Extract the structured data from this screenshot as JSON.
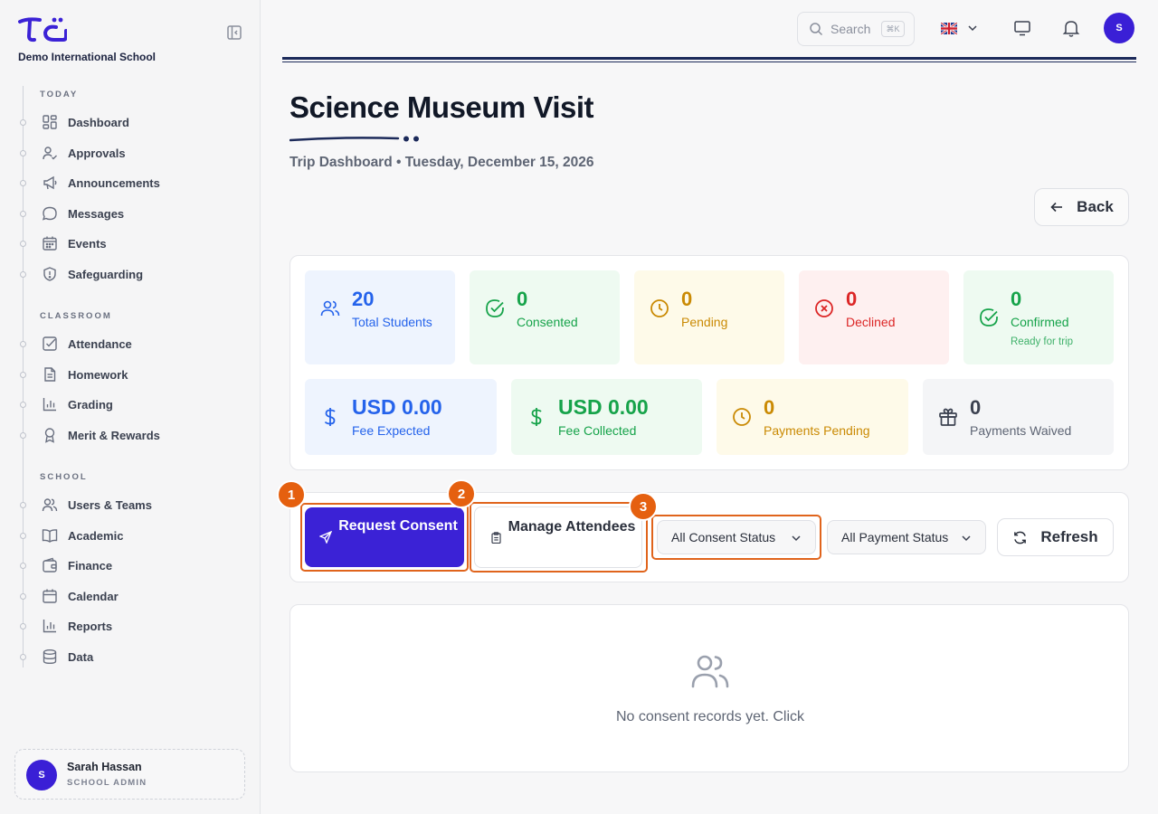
{
  "sidebar": {
    "school_name": "Demo International School",
    "sections": [
      {
        "label": "TODAY",
        "items": [
          {
            "label": "Dashboard",
            "icon": "dashboard-icon"
          },
          {
            "label": "Approvals",
            "icon": "user-check-icon"
          },
          {
            "label": "Announcements",
            "icon": "megaphone-icon"
          },
          {
            "label": "Messages",
            "icon": "chat-bubble-icon"
          },
          {
            "label": "Events",
            "icon": "calendar-grid-icon"
          },
          {
            "label": "Safeguarding",
            "icon": "shield-icon"
          }
        ]
      },
      {
        "label": "CLASSROOM",
        "items": [
          {
            "label": "Attendance",
            "icon": "checkbox-icon"
          },
          {
            "label": "Homework",
            "icon": "document-icon"
          },
          {
            "label": "Grading",
            "icon": "bar-chart-icon"
          },
          {
            "label": "Merit & Rewards",
            "icon": "award-icon"
          }
        ]
      },
      {
        "label": "SCHOOL",
        "items": [
          {
            "label": "Users & Teams",
            "icon": "users-icon"
          },
          {
            "label": "Academic",
            "icon": "book-icon"
          },
          {
            "label": "Finance",
            "icon": "wallet-icon"
          },
          {
            "label": "Calendar",
            "icon": "calendar-icon"
          },
          {
            "label": "Reports",
            "icon": "bar-chart-icon"
          },
          {
            "label": "Data",
            "icon": "database-icon"
          }
        ]
      }
    ],
    "user": {
      "initial": "S",
      "name": "Sarah Hassan",
      "role": "SCHOOL ADMIN"
    }
  },
  "topbar": {
    "search_placeholder": "Search",
    "search_shortcut": "⌘K",
    "user_initial": "S"
  },
  "page": {
    "title": "Science Museum Visit",
    "subtitle": "Trip Dashboard • Tuesday, December 15, 2026",
    "back_label": "Back"
  },
  "stats": {
    "total_students": {
      "value": "20",
      "label": "Total Students"
    },
    "consented": {
      "value": "0",
      "label": "Consented"
    },
    "pending": {
      "value": "0",
      "label": "Pending"
    },
    "declined": {
      "value": "0",
      "label": "Declined"
    },
    "confirmed": {
      "value": "0",
      "label": "Confirmed",
      "note": "Ready for trip"
    },
    "fee_expected": {
      "value": "USD 0.00",
      "label": "Fee Expected"
    },
    "fee_collected": {
      "value": "USD 0.00",
      "label": "Fee Collected"
    },
    "payments_pending": {
      "value": "0",
      "label": "Payments Pending"
    },
    "payments_waived": {
      "value": "0",
      "label": "Payments Waived"
    }
  },
  "actions": {
    "request_consent": "Request Consent",
    "manage_attendees": "Manage Attendees",
    "consent_filter": "All Consent Status",
    "payment_filter": "All Payment Status",
    "refresh": "Refresh",
    "badges": [
      "1",
      "2",
      "3"
    ]
  },
  "empty_state": {
    "text": "No consent records yet. Click"
  },
  "colors": {
    "primary": "#3b22d6",
    "highlight": "#e0641c",
    "blue": "#2563eb",
    "green": "#16a34a",
    "amber": "#ca8a04",
    "red": "#dc2626"
  }
}
